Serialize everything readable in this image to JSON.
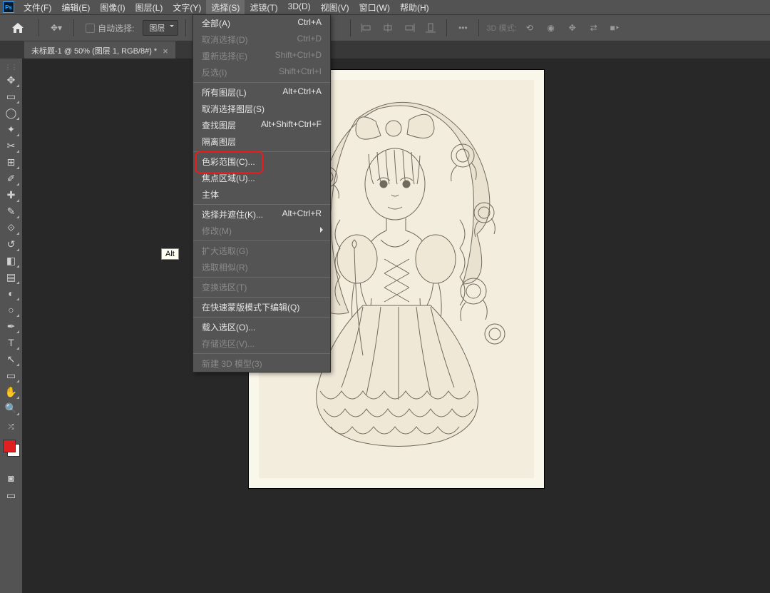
{
  "menubar": [
    "文件(F)",
    "编辑(E)",
    "图像(I)",
    "图层(L)",
    "文字(Y)",
    "选择(S)",
    "滤镜(T)",
    "3D(D)",
    "视图(V)",
    "窗口(W)",
    "帮助(H)"
  ],
  "menubar_open_index": 5,
  "optbar": {
    "auto_select": "自动选择:",
    "layer_dd": "图层",
    "mode3d": "3D 模式:"
  },
  "doc_tab": {
    "title": "未标题-1 @ 50% (图层 1, RGB/8#) *",
    "close": "×"
  },
  "alt_tip": "Alt",
  "dropdown": [
    {
      "t": "row",
      "label": "全部(A)",
      "sc": "Ctrl+A"
    },
    {
      "t": "row",
      "label": "取消选择(D)",
      "sc": "Ctrl+D",
      "dis": true
    },
    {
      "t": "row",
      "label": "重新选择(E)",
      "sc": "Shift+Ctrl+D",
      "dis": true
    },
    {
      "t": "row",
      "label": "反选(I)",
      "sc": "Shift+Ctrl+I",
      "dis": true
    },
    {
      "t": "sep"
    },
    {
      "t": "row",
      "label": "所有图层(L)",
      "sc": "Alt+Ctrl+A"
    },
    {
      "t": "row",
      "label": "取消选择图层(S)"
    },
    {
      "t": "row",
      "label": "查找图层",
      "sc": "Alt+Shift+Ctrl+F"
    },
    {
      "t": "row",
      "label": "隔离图层"
    },
    {
      "t": "sep"
    },
    {
      "t": "row",
      "label": "色彩范围(C)...",
      "hl": true
    },
    {
      "t": "row",
      "label": "焦点区域(U)..."
    },
    {
      "t": "row",
      "label": "主体"
    },
    {
      "t": "sep"
    },
    {
      "t": "row",
      "label": "选择并遮住(K)...",
      "sc": "Alt+Ctrl+R"
    },
    {
      "t": "row",
      "label": "修改(M)",
      "sub": true,
      "dis": true
    },
    {
      "t": "sep"
    },
    {
      "t": "row",
      "label": "扩大选取(G)",
      "dis": true
    },
    {
      "t": "row",
      "label": "选取相似(R)",
      "dis": true
    },
    {
      "t": "sep"
    },
    {
      "t": "row",
      "label": "变换选区(T)",
      "dis": true
    },
    {
      "t": "sep"
    },
    {
      "t": "row",
      "label": "在快速蒙版模式下编辑(Q)"
    },
    {
      "t": "sep"
    },
    {
      "t": "row",
      "label": "载入选区(O)..."
    },
    {
      "t": "row",
      "label": "存储选区(V)...",
      "dis": true
    },
    {
      "t": "sep"
    },
    {
      "t": "row",
      "label": "新建 3D 模型(3)",
      "dis": true
    }
  ],
  "tools": [
    {
      "n": "move-tool",
      "g": "✥"
    },
    {
      "n": "marquee-tool",
      "g": "▭"
    },
    {
      "n": "lasso-tool",
      "g": "◯"
    },
    {
      "n": "quick-select-tool",
      "g": "✦"
    },
    {
      "n": "crop-tool",
      "g": "✂"
    },
    {
      "n": "frame-tool",
      "g": "⊞"
    },
    {
      "n": "eyedropper-tool",
      "g": "✐"
    },
    {
      "n": "healing-tool",
      "g": "✚"
    },
    {
      "n": "brush-tool",
      "g": "✎"
    },
    {
      "n": "stamp-tool",
      "g": "⟐"
    },
    {
      "n": "history-brush-tool",
      "g": "↺"
    },
    {
      "n": "eraser-tool",
      "g": "◧"
    },
    {
      "n": "gradient-tool",
      "g": "▤"
    },
    {
      "n": "blur-tool",
      "g": "◐"
    },
    {
      "n": "dodge-tool",
      "g": "○"
    },
    {
      "n": "pen-tool",
      "g": "✒"
    },
    {
      "n": "type-tool",
      "g": "T"
    },
    {
      "n": "path-select-tool",
      "g": "↖"
    },
    {
      "n": "rectangle-tool",
      "g": "▭"
    },
    {
      "n": "hand-tool",
      "g": "✋"
    },
    {
      "n": "zoom-tool",
      "g": "🔍"
    }
  ]
}
